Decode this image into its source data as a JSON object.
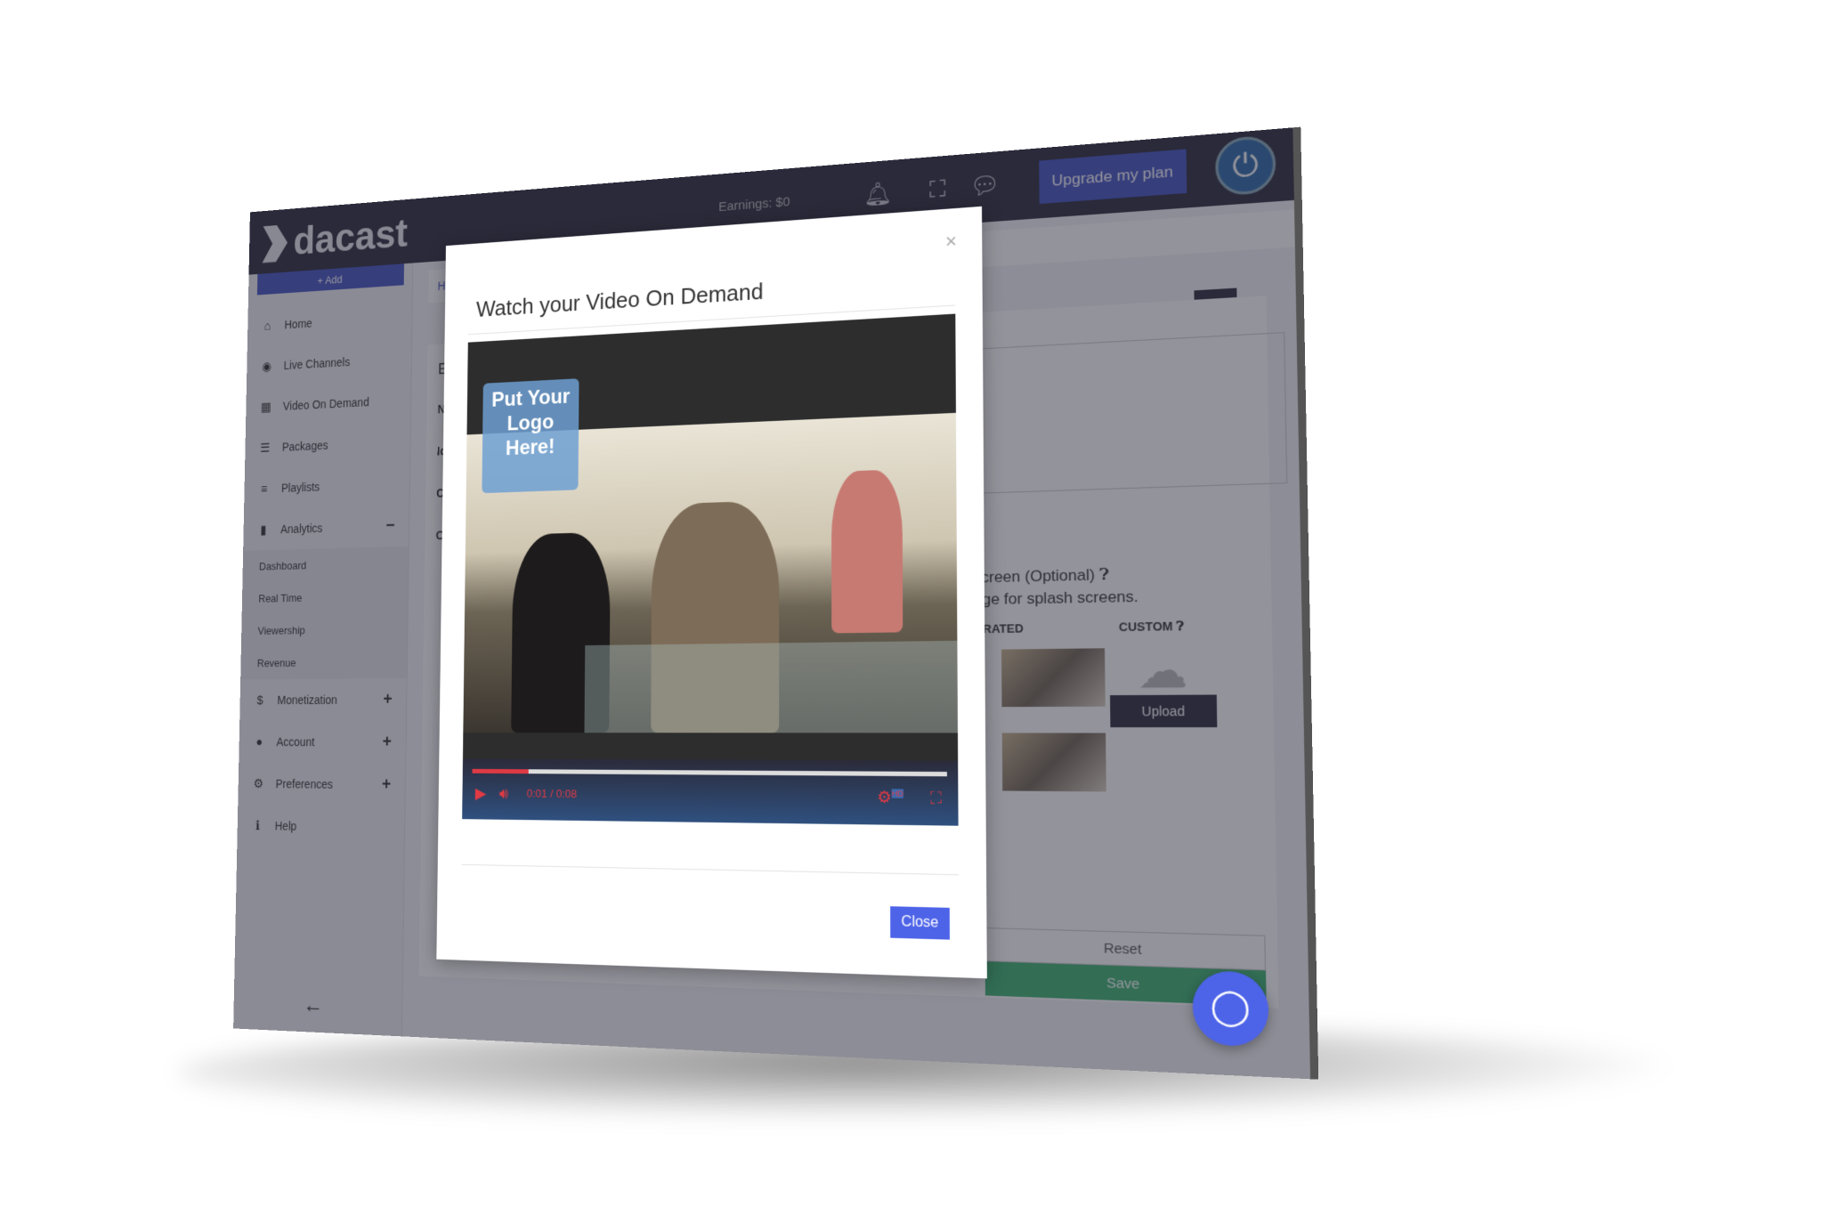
{
  "topbar": {
    "brand": "dacast",
    "earnings": "Earnings: $0",
    "upgrade": "Upgrade my plan"
  },
  "sidebar": {
    "add": "+ Add",
    "items": [
      {
        "label": "Home",
        "icon": "⌂"
      },
      {
        "label": "Live Channels",
        "icon": "◉"
      },
      {
        "label": "Video On Demand",
        "icon": "▦"
      },
      {
        "label": "Packages",
        "icon": "☰"
      },
      {
        "label": "Playlists",
        "icon": "≡"
      },
      {
        "label": "Analytics",
        "icon": "▮",
        "toggle": "−"
      }
    ],
    "analytics_sub": [
      "Dashboard",
      "Real Time",
      "Viewership",
      "Revenue"
    ],
    "items2": [
      {
        "label": "Monetization",
        "icon": "$",
        "toggle": "+"
      },
      {
        "label": "Account",
        "icon": "●",
        "toggle": "+"
      },
      {
        "label": "Preferences",
        "icon": "⚙",
        "toggle": "+"
      },
      {
        "label": "Help",
        "icon": "ℹ"
      }
    ]
  },
  "main": {
    "breadcrumb": "Ho",
    "edit_heading": "Ed",
    "labels": [
      "Na",
      "Id",
      "Ca",
      "Or"
    ],
    "splash_title": "screen (Optional)",
    "splash_desc": "age for splash screens.",
    "generated": "RATED",
    "custom": "CUSTOM",
    "upload_label": "Upload",
    "reset": "Reset",
    "save": "Save"
  },
  "modal": {
    "title": "Watch your Video On Demand",
    "close_x": "×",
    "close": "Close",
    "player": {
      "logo_text": "Put Your Logo Here!",
      "current": "0:01",
      "duration": "0:08",
      "progress": 0.125,
      "quality": "HD"
    }
  },
  "colors": {
    "accent": "#4454c0",
    "dark": "#2d2c3c",
    "player_red": "#e03a44",
    "save": "#3cb371"
  }
}
